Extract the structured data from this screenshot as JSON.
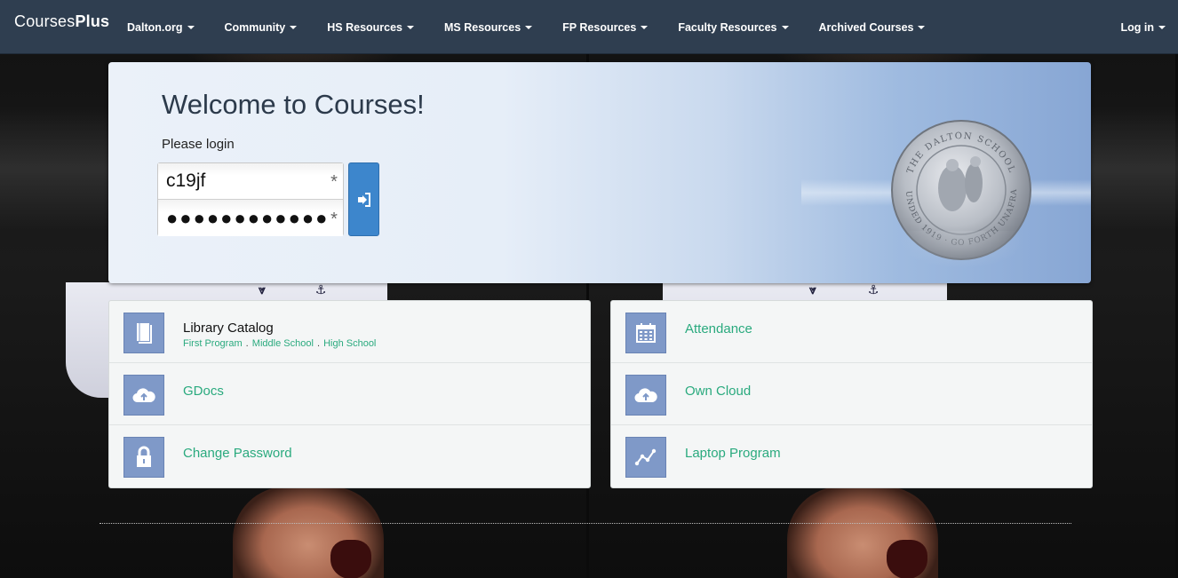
{
  "navbar": {
    "brand_light": "Courses",
    "brand_bold": "Plus",
    "items": [
      {
        "label": "Dalton.org"
      },
      {
        "label": "Community"
      },
      {
        "label": "HS Resources"
      },
      {
        "label": "MS Resources"
      },
      {
        "label": "FP Resources"
      },
      {
        "label": "Faculty Resources"
      },
      {
        "label": "Archived Courses"
      }
    ],
    "login_label": "Log in"
  },
  "login": {
    "title": "Welcome to Courses!",
    "prompt": "Please login",
    "username_value": "c19jf",
    "password_value": "●●●●●●●●●●●●",
    "required_mark": "*"
  },
  "seal": {
    "text_top": "THE DALTON SCHOOL",
    "text_bottom": "FOUNDED 1919 · GO FORTH UNAFRAID"
  },
  "links_left": [
    {
      "label": "Library Catalog",
      "icon": "book-icon",
      "sublinks": [
        "First Program",
        "Middle School",
        "High School"
      ]
    },
    {
      "label": "GDocs",
      "icon": "cloud-upload-icon"
    },
    {
      "label": "Change Password",
      "icon": "lock-icon"
    }
  ],
  "links_right": [
    {
      "label": "Attendance",
      "icon": "calendar-icon"
    },
    {
      "label": "Own Cloud",
      "icon": "cloud-upload-icon"
    },
    {
      "label": "Laptop Program",
      "icon": "line-chart-icon"
    }
  ],
  "colors": {
    "navbar": "#2f3e50",
    "accent_green": "#2aaa7e",
    "tile_blue": "#7f99c8",
    "button_blue": "#3d86cc"
  }
}
